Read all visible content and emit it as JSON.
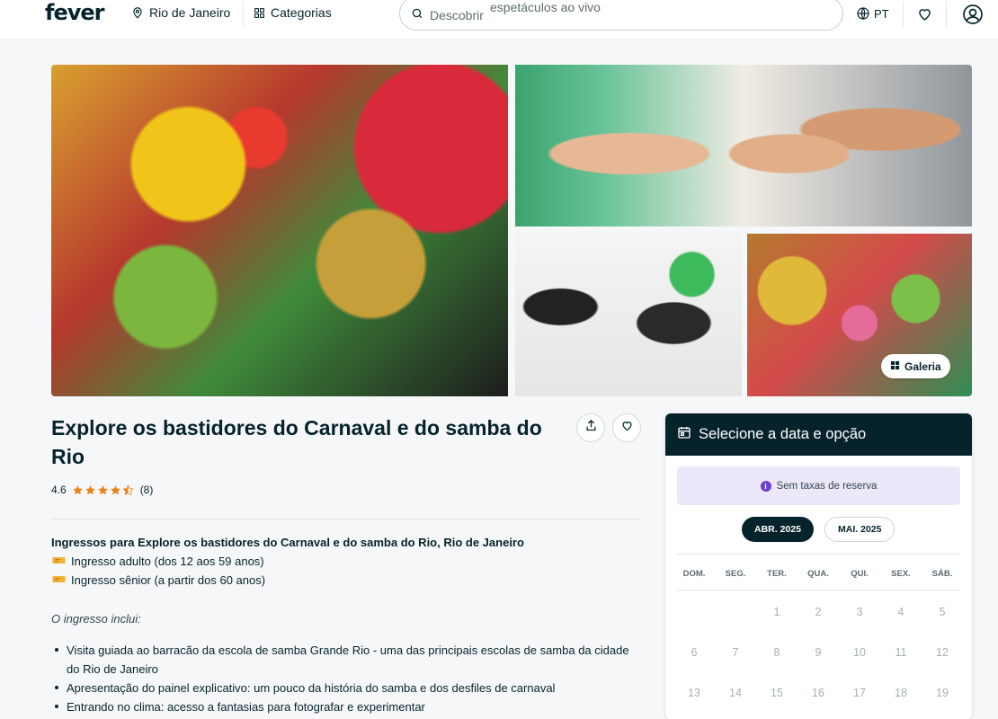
{
  "header": {
    "logo": "fever",
    "location": "Rio de Janeiro",
    "categories_label": "Categorias",
    "search_placeholder": "Descobrir",
    "search_suggestion": "espetáculos ao vivo",
    "language": "PT"
  },
  "gallery": {
    "button_label": "Galeria"
  },
  "event": {
    "title": "Explore os bastidores do Carnaval e do samba do Rio",
    "rating": "4.6",
    "review_count": "(8)",
    "stars": 4.5
  },
  "tickets": {
    "heading": "Ingressos para Explore os bastidores do Carnaval e do samba do Rio, Rio de Janeiro",
    "items": [
      "Ingresso adulto (dos 12 aos 59 anos)",
      "Ingresso sênior (a partir dos 60 anos)"
    ]
  },
  "includes": {
    "label": "O ingresso inclui:",
    "items": [
      "Visita guiada ao barracão da escola de samba Grande Rio - uma das principais escolas de samba da cidade do Rio de Janeiro",
      "Apresentação do painel explicativo: um pouco da história do samba e dos desfiles de carnaval",
      "Entrando no clima: acesso a fantasias para fotografar e experimentar"
    ]
  },
  "booking": {
    "title": "Selecione a data e opção",
    "notice": "Sem taxas de reserva",
    "months": [
      "ABR. 2025",
      "MAI. 2025"
    ],
    "weekdays": [
      "DOM.",
      "SEG.",
      "TER.",
      "QUA.",
      "QUI.",
      "SEX.",
      "SÁB."
    ],
    "weeks": [
      [
        "",
        "",
        "1",
        "2",
        "3",
        "4",
        "5"
      ],
      [
        "6",
        "7",
        "8",
        "9",
        "10",
        "11",
        "12"
      ],
      [
        "13",
        "14",
        "15",
        "16",
        "17",
        "18",
        "19"
      ]
    ]
  },
  "colors": {
    "brand_dark": "#06232c",
    "notice_bg": "#ece7f9",
    "info_purple": "#6a3fd0",
    "star": "#e8841a"
  }
}
